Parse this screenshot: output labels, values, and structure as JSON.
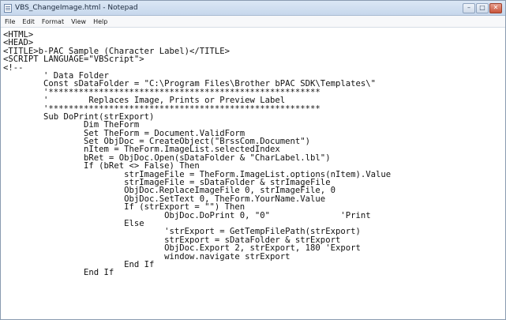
{
  "window": {
    "title": "VBS_ChangeImage.html - Notepad",
    "controls": [
      "–",
      "□",
      "✕"
    ]
  },
  "menu": [
    "File",
    "Edit",
    "Format",
    "View",
    "Help"
  ],
  "code_lines": [
    "<HTML>",
    "<HEAD>",
    "<TITLE>b-PAC Sample (Character Label)</TITLE>",
    "<SCRIPT LANGUAGE=\"VBScript\">",
    "<!--",
    "        ' Data Folder",
    "        Const sDataFolder = \"C:\\Program Files\\Brother bPAC SDK\\Templates\\\"",
    "        '******************************************************",
    "        '        Replaces Image, Prints or Preview Label",
    "        '******************************************************",
    "        Sub DoPrint(strExport)",
    "                Dim TheForm",
    "                Set TheForm = Document.ValidForm",
    "                Set ObjDoc = CreateObject(\"BrssCom.Document\")",
    "                nItem = TheForm.ImageList.selectedIndex",
    "                bRet = ObjDoc.Open(sDataFolder & \"CharLabel.lbl\")",
    "                If (bRet <> False) Then",
    "                        strImageFile = TheForm.ImageList.options(nItem).Value",
    "                        strImageFile = sDataFolder & strImageFile",
    "                        ObjDoc.ReplaceImageFile 0, strImageFile, 0",
    "                        ObjDoc.SetText 0, TheForm.YourName.Value",
    "                        If (strExport = \"\") Then",
    "                                ObjDoc.DoPrint 0, \"0\"              'Print",
    "                        Else",
    "                                'strExport = GetTempFilePath(strExport)",
    "                                strExport = sDataFolder & strExport",
    "                                ObjDoc.Export 2, strExport, 180 'Export",
    "                                window.navigate strExport",
    "                        End If",
    "                End If"
  ]
}
